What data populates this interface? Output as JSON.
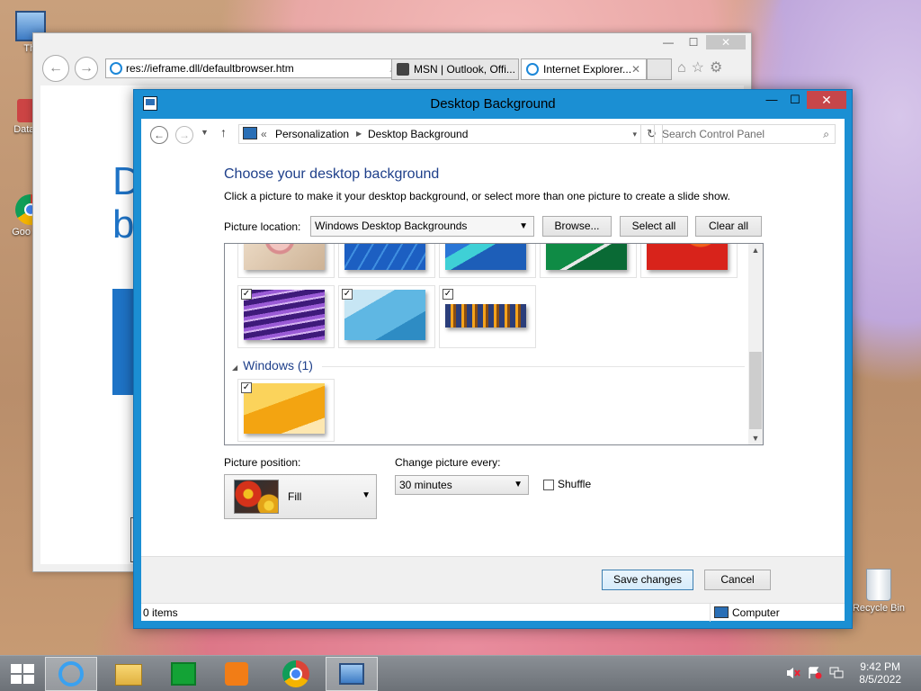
{
  "desktop": {
    "icons": [
      {
        "label": "Thi",
        "name": "this-pc"
      },
      {
        "label": "DataW",
        "name": "dataw"
      },
      {
        "label": "Goo Chr",
        "name": "google-chrome"
      }
    ],
    "recycle_bin_label": "Recycle Bin"
  },
  "ie": {
    "address": "res://ieframe.dll/defaultbrowser.htm",
    "tabs": [
      "MSN | Outlook, Offi...",
      "Internet Explorer..."
    ],
    "content_letters": [
      "D",
      "b"
    ]
  },
  "window": {
    "title": "Desktop Background",
    "breadcrumb": {
      "prefix": "«",
      "items": [
        "Personalization",
        "Desktop Background"
      ]
    },
    "search_placeholder": "Search Control Panel",
    "heading": "Choose your desktop background",
    "subheading": "Click a picture to make it your desktop background, or select more than one picture to create a slide show.",
    "picture_location": {
      "label": "Picture location:",
      "value": "Windows Desktop Backgrounds"
    },
    "buttons": {
      "browse": "Browse...",
      "select_all": "Select all",
      "clear_all": "Clear all"
    },
    "group": {
      "name": "Windows (1)"
    },
    "thumbnails": [
      {
        "name": "cartoon-pig",
        "checked": false,
        "colors": [
          "#e9d4c0",
          "#d98d8f"
        ]
      },
      {
        "name": "blue-lines",
        "checked": false,
        "colors": [
          "#1c5fc2",
          "#4aa1e6"
        ]
      },
      {
        "name": "blue-geometric",
        "checked": false,
        "colors": [
          "#2a76d6",
          "#3fd0d6"
        ]
      },
      {
        "name": "green-stripe",
        "checked": false,
        "colors": [
          "#0f8b45",
          "#4fc07a"
        ]
      },
      {
        "name": "red-orange",
        "checked": false,
        "colors": [
          "#d8231b",
          "#f0601c"
        ]
      },
      {
        "name": "purple-waves",
        "checked": true,
        "colors": [
          "#5b2aa0",
          "#b46fe0"
        ]
      },
      {
        "name": "light-blue-curve",
        "checked": true,
        "colors": [
          "#5fb7e3",
          "#c7e6f4"
        ]
      },
      {
        "name": "city-night",
        "checked": true,
        "colors": [
          "#2b3e7a",
          "#f5a31c"
        ]
      },
      {
        "name": "windows-yellow",
        "checked": true,
        "colors": [
          "#f3a411",
          "#fbd35b"
        ]
      }
    ],
    "picture_position": {
      "label": "Picture position:",
      "value": "Fill"
    },
    "change_every": {
      "label": "Change picture every:",
      "value": "30 minutes"
    },
    "shuffle": {
      "label": "Shuffle",
      "checked": false
    },
    "save_button": "Save changes",
    "cancel_button": "Cancel",
    "status": {
      "items": "0 items",
      "location": "Computer"
    }
  },
  "taskbar": {
    "apps": [
      "start",
      "internet-explorer",
      "file-explorer",
      "store",
      "media-player",
      "chrome",
      "control-panel"
    ],
    "time": "9:42 PM",
    "date": "8/5/2022"
  }
}
